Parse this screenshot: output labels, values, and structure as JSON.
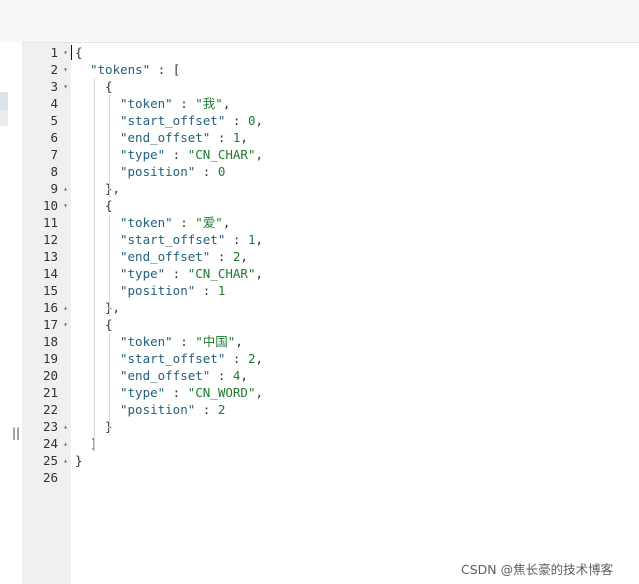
{
  "resize_handle_glyph": "||",
  "watermark": "CSDN @焦长豪的技术博客",
  "code": {
    "lines": [
      {
        "n": "1",
        "fold": "▾",
        "indent": 0,
        "tokens": [
          {
            "t": "p",
            "v": "{"
          }
        ]
      },
      {
        "n": "2",
        "fold": "▾",
        "indent": 1,
        "tokens": [
          {
            "t": "k",
            "v": "\"tokens\""
          },
          {
            "t": "p",
            "v": " : ["
          }
        ]
      },
      {
        "n": "3",
        "fold": "▾",
        "indent": 2,
        "tokens": [
          {
            "t": "p",
            "v": "{"
          }
        ]
      },
      {
        "n": "4",
        "fold": "",
        "indent": 3,
        "tokens": [
          {
            "t": "k",
            "v": "\"token\""
          },
          {
            "t": "p",
            "v": " : "
          },
          {
            "t": "s",
            "v": "\"我\""
          },
          {
            "t": "p",
            "v": ","
          }
        ]
      },
      {
        "n": "5",
        "fold": "",
        "indent": 3,
        "tokens": [
          {
            "t": "k",
            "v": "\"start_offset\""
          },
          {
            "t": "p",
            "v": " : "
          },
          {
            "t": "n",
            "v": "0"
          },
          {
            "t": "p",
            "v": ","
          }
        ]
      },
      {
        "n": "6",
        "fold": "",
        "indent": 3,
        "tokens": [
          {
            "t": "k",
            "v": "\"end_offset\""
          },
          {
            "t": "p",
            "v": " : "
          },
          {
            "t": "n",
            "v": "1"
          },
          {
            "t": "p",
            "v": ","
          }
        ]
      },
      {
        "n": "7",
        "fold": "",
        "indent": 3,
        "tokens": [
          {
            "t": "k",
            "v": "\"type\""
          },
          {
            "t": "p",
            "v": " : "
          },
          {
            "t": "s",
            "v": "\"CN_CHAR\""
          },
          {
            "t": "p",
            "v": ","
          }
        ]
      },
      {
        "n": "8",
        "fold": "",
        "indent": 3,
        "tokens": [
          {
            "t": "k",
            "v": "\"position\""
          },
          {
            "t": "p",
            "v": " : "
          },
          {
            "t": "n",
            "v": "0"
          }
        ]
      },
      {
        "n": "9",
        "fold": "▴",
        "indent": 2,
        "tokens": [
          {
            "t": "p",
            "v": "},"
          }
        ]
      },
      {
        "n": "10",
        "fold": "▾",
        "indent": 2,
        "tokens": [
          {
            "t": "p",
            "v": "{"
          }
        ]
      },
      {
        "n": "11",
        "fold": "",
        "indent": 3,
        "tokens": [
          {
            "t": "k",
            "v": "\"token\""
          },
          {
            "t": "p",
            "v": " : "
          },
          {
            "t": "s",
            "v": "\"爱\""
          },
          {
            "t": "p",
            "v": ","
          }
        ]
      },
      {
        "n": "12",
        "fold": "",
        "indent": 3,
        "tokens": [
          {
            "t": "k",
            "v": "\"start_offset\""
          },
          {
            "t": "p",
            "v": " : "
          },
          {
            "t": "n",
            "v": "1"
          },
          {
            "t": "p",
            "v": ","
          }
        ]
      },
      {
        "n": "13",
        "fold": "",
        "indent": 3,
        "tokens": [
          {
            "t": "k",
            "v": "\"end_offset\""
          },
          {
            "t": "p",
            "v": " : "
          },
          {
            "t": "n",
            "v": "2"
          },
          {
            "t": "p",
            "v": ","
          }
        ]
      },
      {
        "n": "14",
        "fold": "",
        "indent": 3,
        "tokens": [
          {
            "t": "k",
            "v": "\"type\""
          },
          {
            "t": "p",
            "v": " : "
          },
          {
            "t": "s",
            "v": "\"CN_CHAR\""
          },
          {
            "t": "p",
            "v": ","
          }
        ]
      },
      {
        "n": "15",
        "fold": "",
        "indent": 3,
        "tokens": [
          {
            "t": "k",
            "v": "\"position\""
          },
          {
            "t": "p",
            "v": " : "
          },
          {
            "t": "n",
            "v": "1"
          }
        ]
      },
      {
        "n": "16",
        "fold": "▴",
        "indent": 2,
        "tokens": [
          {
            "t": "p",
            "v": "},"
          }
        ]
      },
      {
        "n": "17",
        "fold": "▾",
        "indent": 2,
        "tokens": [
          {
            "t": "p",
            "v": "{"
          }
        ]
      },
      {
        "n": "18",
        "fold": "",
        "indent": 3,
        "tokens": [
          {
            "t": "k",
            "v": "\"token\""
          },
          {
            "t": "p",
            "v": " : "
          },
          {
            "t": "s",
            "v": "\"中国\""
          },
          {
            "t": "p",
            "v": ","
          }
        ]
      },
      {
        "n": "19",
        "fold": "",
        "indent": 3,
        "tokens": [
          {
            "t": "k",
            "v": "\"start_offset\""
          },
          {
            "t": "p",
            "v": " : "
          },
          {
            "t": "n",
            "v": "2"
          },
          {
            "t": "p",
            "v": ","
          }
        ]
      },
      {
        "n": "20",
        "fold": "",
        "indent": 3,
        "tokens": [
          {
            "t": "k",
            "v": "\"end_offset\""
          },
          {
            "t": "p",
            "v": " : "
          },
          {
            "t": "n",
            "v": "4"
          },
          {
            "t": "p",
            "v": ","
          }
        ]
      },
      {
        "n": "21",
        "fold": "",
        "indent": 3,
        "tokens": [
          {
            "t": "k",
            "v": "\"type\""
          },
          {
            "t": "p",
            "v": " : "
          },
          {
            "t": "s",
            "v": "\"CN_WORD\""
          },
          {
            "t": "p",
            "v": ","
          }
        ]
      },
      {
        "n": "22",
        "fold": "",
        "indent": 3,
        "tokens": [
          {
            "t": "k",
            "v": "\"position\""
          },
          {
            "t": "p",
            "v": " : "
          },
          {
            "t": "n",
            "v": "2"
          }
        ]
      },
      {
        "n": "23",
        "fold": "▴",
        "indent": 2,
        "tokens": [
          {
            "t": "p",
            "v": "}"
          }
        ]
      },
      {
        "n": "24",
        "fold": "▴",
        "indent": 1,
        "tokens": [
          {
            "t": "p",
            "v": "]"
          }
        ]
      },
      {
        "n": "25",
        "fold": "▴",
        "indent": 0,
        "tokens": [
          {
            "t": "p",
            "v": "}"
          }
        ]
      },
      {
        "n": "26",
        "fold": "",
        "indent": 0,
        "tokens": []
      }
    ]
  }
}
